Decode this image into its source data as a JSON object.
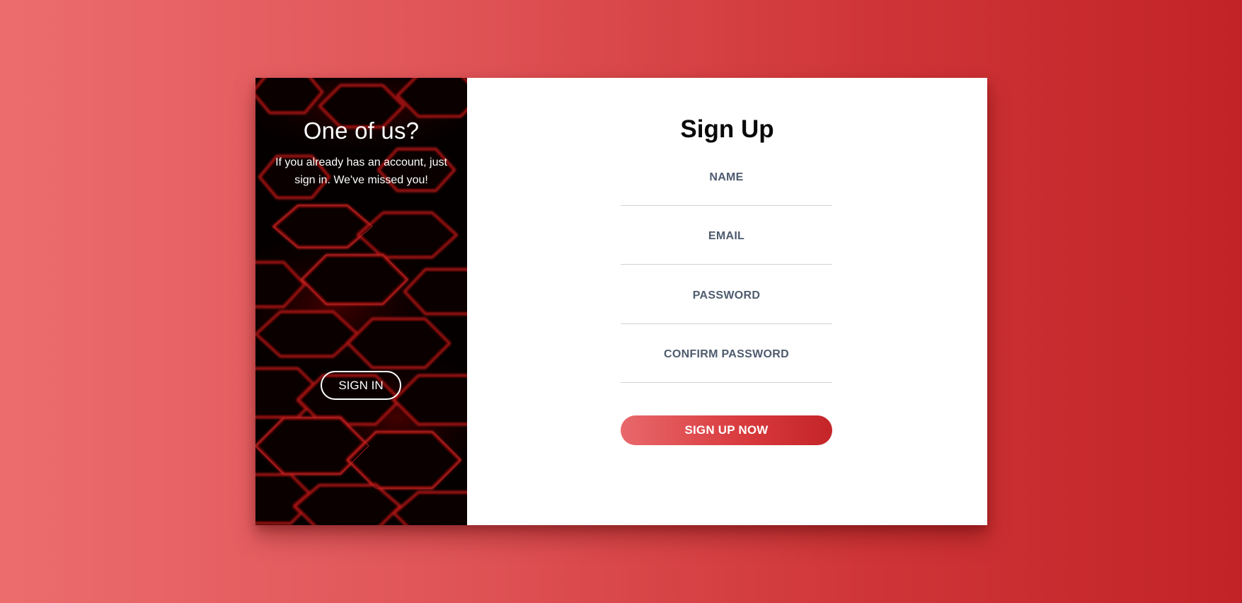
{
  "left_panel": {
    "title": "One of us?",
    "text": "If you already has an account, just sign in. We've missed you!",
    "signin_button": "SIGN IN",
    "background": "hexagon-pattern"
  },
  "form": {
    "title": "Sign Up",
    "name_placeholder": "NAME",
    "email_placeholder": "EMAIL",
    "password_placeholder": "PASSWORD",
    "confirm_password_placeholder": "CONFIRM PASSWORD",
    "submit_button": "SIGN UP NOW"
  },
  "colors": {
    "accent": "#d8393c",
    "background_start": "#ec6c6e",
    "background_end": "#c22326",
    "glow": "#ff1a1a"
  }
}
